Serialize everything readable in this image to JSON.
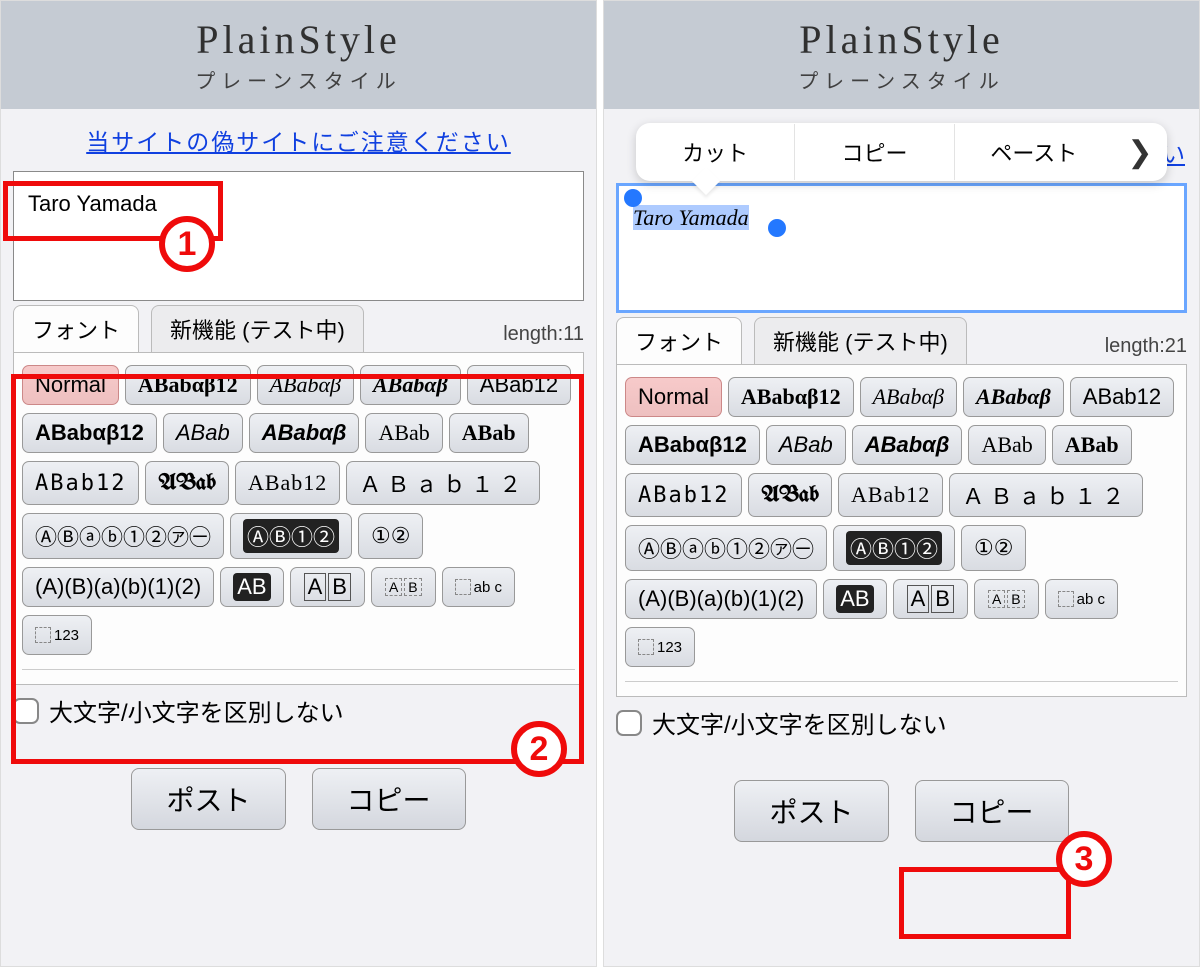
{
  "app": {
    "title": "PlainStyle",
    "subtitle": "プレーンスタイル"
  },
  "warning_link": "当サイトの偽サイトにご注意ください",
  "warning_peek": "さい",
  "left": {
    "text_input": "Taro Yamada",
    "length_label": "length:11"
  },
  "right": {
    "text_input": "Taro Yamada",
    "length_label": "length:21"
  },
  "tabs": {
    "font": "フォント",
    "new_feature": "新機能 (テスト中)"
  },
  "font_buttons": {
    "normal": "Normal",
    "serif_bold": "ABabαβ12",
    "serif_italic": "ABabαβ",
    "serif_bold_italic": "ABabαβ",
    "sans": "ABab12",
    "sans_bold": "ABabαβ12",
    "sans_italic": "ABab",
    "sans_bold_italic": "ABabαβ",
    "script": "ABab",
    "script_bold": "ABab",
    "mono": "ABab12",
    "fraktur": "ABab",
    "double": "ABab12",
    "fullwidth": "ＡＢａｂ１２",
    "circled": "ⒶⒷⓐⓑ①②㋐㊀",
    "neg_circled": "ⒶⒷ①②",
    "double_circled": "①②",
    "paren": "(A)(B)(a)(b)(1)(2)",
    "neg_squared": "AB",
    "squared": "AB",
    "region": "A B",
    "sup": "ab c",
    "sub": "123"
  },
  "checkbox_label": "大文字/小文字を区別しない",
  "actions": {
    "post": "ポスト",
    "copy": "コピー"
  },
  "context_menu": {
    "cut": "カット",
    "copy": "コピー",
    "paste": "ペースト",
    "more": "❯"
  },
  "annotations": {
    "one": "1",
    "two": "2",
    "three": "3"
  }
}
